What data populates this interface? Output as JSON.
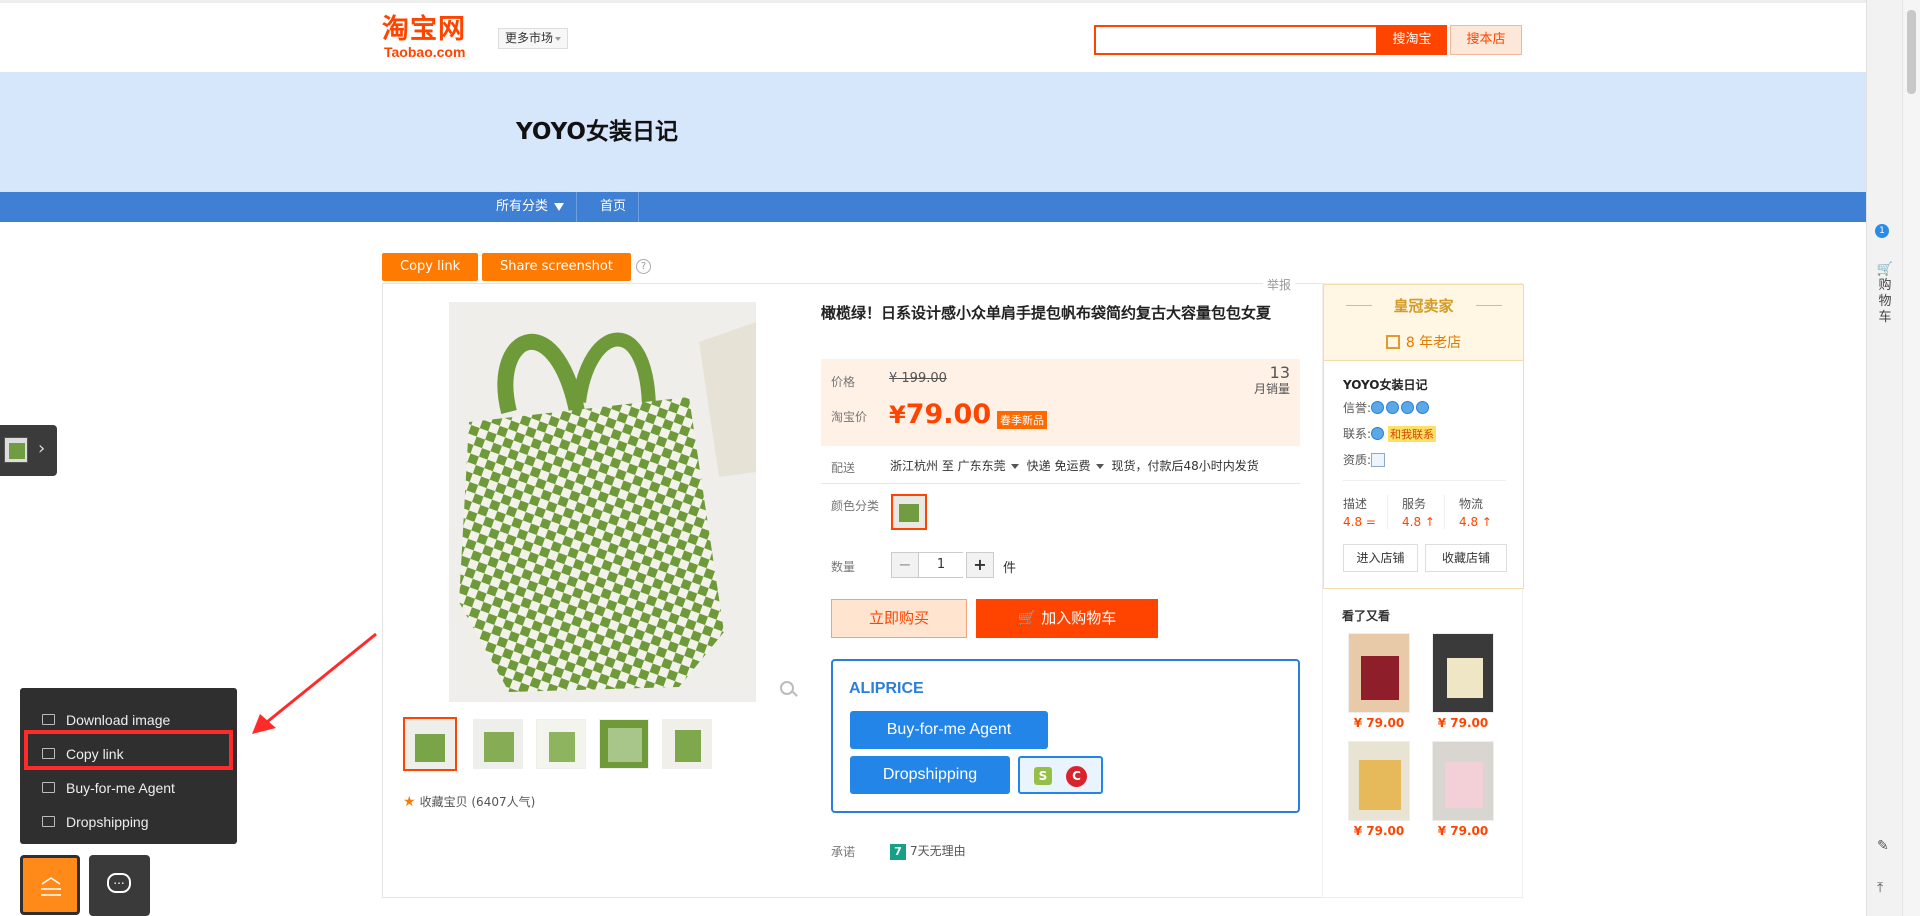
{
  "header": {
    "logo_cn": "淘宝网",
    "logo_en": "Taobao.com",
    "market_label": "更多市场",
    "search_value": "",
    "search_taobao_label": "搜淘宝",
    "search_store_label": "搜本店"
  },
  "shop": {
    "title": "YOYO女装日记",
    "nav": [
      {
        "label": "所有分类"
      },
      {
        "label": "首页"
      }
    ]
  },
  "extension_buttons": {
    "copy_link": "Copy link",
    "share_screenshot": "Share screenshot",
    "help": "?"
  },
  "product": {
    "report": "举报",
    "title": "橄榄绿！日系设计感小众单肩手提包帆布袋简约复古大容量包包女夏",
    "price_label": "价格",
    "original_price": "¥ 199.00",
    "taobao_price_label": "淘宝价",
    "price_currency": "¥",
    "price_value": "79.00",
    "price_tag": "春季新品",
    "monthly_sales_num": "13",
    "monthly_sales_label": "月销量",
    "shipping_label": "配送",
    "ship_from": "浙江杭州 至",
    "ship_to": "广东东莞",
    "ship_method": "快递 免运费",
    "ship_note": "现货，付款后48小时内发货",
    "color_label": "颜色分类",
    "qty_label": "数量",
    "qty_minus": "−",
    "qty_value": "1",
    "qty_plus": "+",
    "qty_unit": "件",
    "buy_now": "立即购买",
    "add_cart": "加入购物车",
    "promise_label": "承诺",
    "promise_icon": "7",
    "promise_value": "7天无理由",
    "favorite": "收藏宝贝 (6407人气)"
  },
  "aliprice": {
    "title": "ALIPRICE",
    "buy_for_me": "Buy-for-me Agent",
    "dropshipping": "Dropshipping",
    "shopify_icon": "S",
    "c_icon": "C"
  },
  "seller": {
    "rank": "皇冠卖家",
    "years": "8 年老店",
    "store_name": "YOYO女装日记",
    "credit_label": "信誉:",
    "contact_label": "联系:",
    "contact_tag": "和我联系",
    "qualification_label": "资质:",
    "ratings": [
      {
        "label": "描述",
        "value": "4.8 ="
      },
      {
        "label": "服务",
        "value": "4.8 ↑"
      },
      {
        "label": "物流",
        "value": "4.8 ↑"
      }
    ],
    "enter_store": "进入店铺",
    "favorite_store": "收藏店铺",
    "also_viewed_title": "看了又看",
    "also_viewed": [
      {
        "price": "¥ 79.00"
      },
      {
        "price": "¥ 79.00"
      },
      {
        "price": "¥ 79.00"
      },
      {
        "price": "¥ 79.00"
      }
    ]
  },
  "right_rail": {
    "badge": "1",
    "cart_label": "购物车"
  },
  "popup_menu": {
    "items": [
      {
        "label": "Download image",
        "icon": "image-icon"
      },
      {
        "label": "Copy link",
        "icon": "copy-link-icon"
      },
      {
        "label": "Buy-for-me Agent",
        "icon": "cart-icon"
      },
      {
        "label": "Dropshipping",
        "icon": "truck-icon"
      }
    ]
  },
  "colors": {
    "taobao_orange": "#ff4400",
    "extension_orange": "#ff7a00",
    "aliprice_blue": "#2385e8",
    "shop_nav_blue": "#3f7fd4",
    "banner_blue": "#d6e6fb",
    "highlight_red": "#ff2a2a"
  }
}
